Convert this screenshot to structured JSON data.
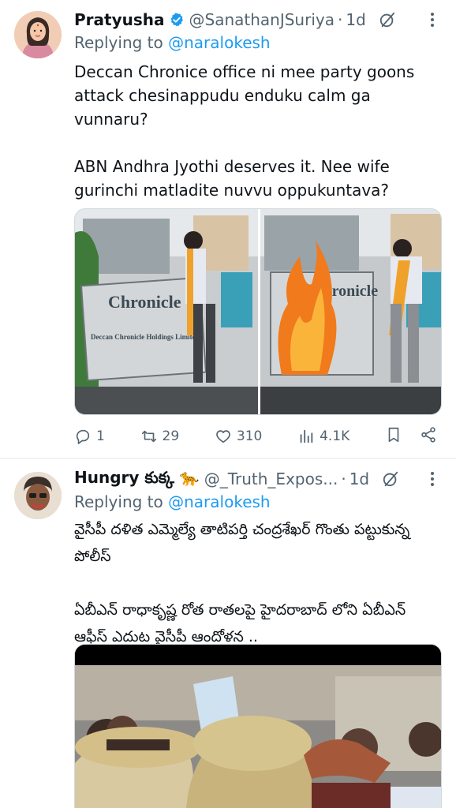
{
  "tweets": [
    {
      "name": "Pratyusha",
      "handle": "@SanathanJSuriya",
      "time": "1d",
      "replying_prefix": "Replying to ",
      "replying_to": "@naralokesh",
      "text": "Deccan Chronice office ni mee party goons attack chesinappudu enduku calm ga vunnaru?\n\nABN Andhra Jyothi deserves it. Nee wife gurinchi matladite nuvvu oppukuntava?",
      "media_sign_text": [
        "Chronicle",
        "Deccan Chronicle Holdings Limited"
      ],
      "stats": {
        "replies": "1",
        "retweets": "29",
        "likes": "310",
        "views": "4.1K"
      }
    },
    {
      "name": "Hungry కుక్క 🐆",
      "handle": "@_Truth_Expos...",
      "time": "1d",
      "replying_prefix": "Replying to ",
      "replying_to": "@naralokesh",
      "text": "వైసీపీ దళిత ఎమ్మెల్యే తాటిపర్తి చంద్రశేఖర్ గొంతు పట్టుకున్న పోలీస్\n\nఏబీఎన్ రాధాకృష్ణ రోత రాతలపై హైదరాబాద్ లోని ఏబీఎన్ ఆఫీస్ ఎదుట వైసీపీ ఆందోళన .."
    }
  ],
  "colors": {
    "accent": "#1d9bf0",
    "muted": "#536471",
    "text": "#0f1419",
    "divider": "#eff3f4"
  },
  "icons": [
    "verified-badge-icon",
    "grok-icon",
    "more-icon",
    "reply-icon",
    "retweet-icon",
    "like-icon",
    "views-icon",
    "bookmark-icon",
    "share-icon"
  ]
}
